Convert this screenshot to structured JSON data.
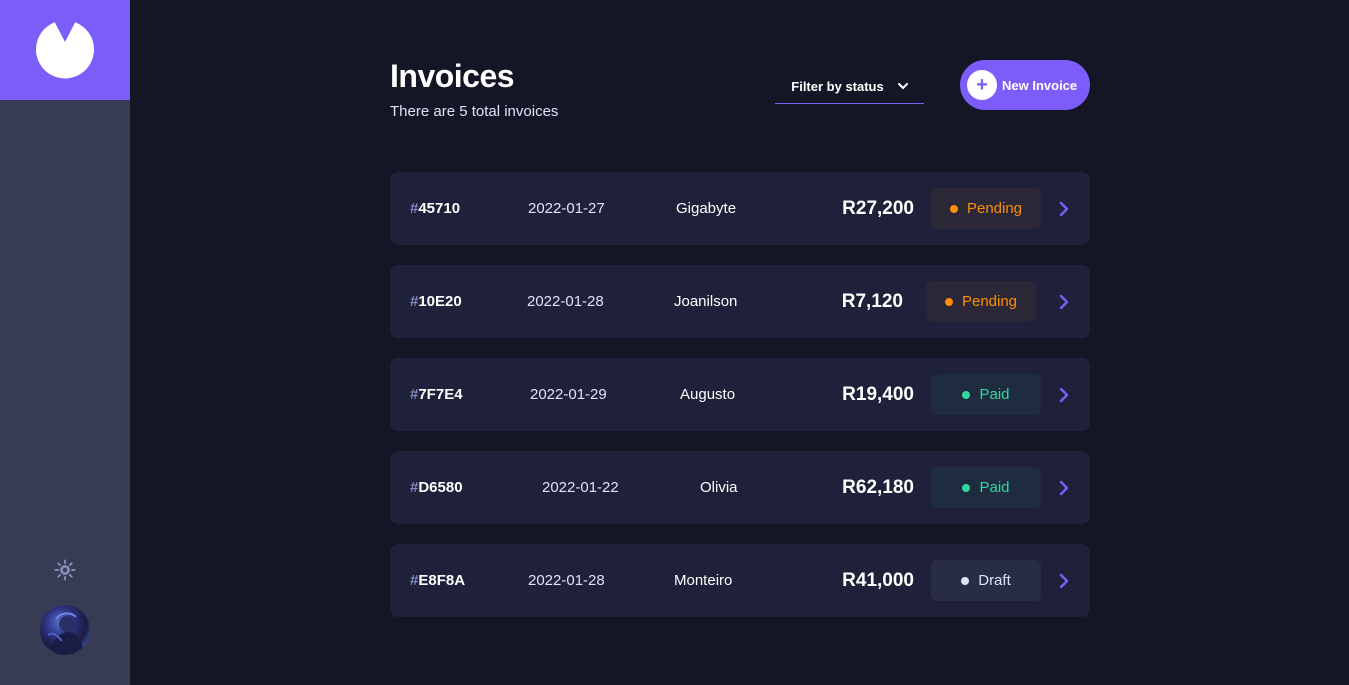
{
  "header": {
    "title": "Invoices",
    "subtitle": "There are 5 total invoices",
    "filter_label": "Filter by status",
    "new_button_label": "New Invoice"
  },
  "colors": {
    "accent": "#7c5dfa",
    "background": "#141625",
    "card": "#1e2139",
    "sidebar": "#373b53",
    "pending": "#ff8f00",
    "paid": "#33d69f",
    "draft": "#dfe3fa"
  },
  "icons": {
    "logo": "logo-icon",
    "theme": "sun-icon",
    "filter": "chevron-down-icon",
    "new": "plus-icon",
    "row": "chevron-right-icon"
  },
  "invoices": [
    {
      "hash": "#",
      "id": "45710",
      "date": "2022-01-27",
      "client": "Gigabyte",
      "amount": "R27,200",
      "status": "Pending",
      "status_key": "pending"
    },
    {
      "hash": "#",
      "id": "10E20",
      "date": "2022-01-28",
      "client": "Joanilson",
      "amount": "R7,120",
      "status": "Pending",
      "status_key": "pending"
    },
    {
      "hash": "#",
      "id": "7F7E4",
      "date": "2022-01-29",
      "client": "Augusto",
      "amount": "R19,400",
      "status": "Paid",
      "status_key": "paid"
    },
    {
      "hash": "#",
      "id": "D6580",
      "date": "2022-01-22",
      "client": "Olivia",
      "amount": "R62,180",
      "status": "Paid",
      "status_key": "paid"
    },
    {
      "hash": "#",
      "id": "E8F8A",
      "date": "2022-01-28",
      "client": "Monteiro",
      "amount": "R41,000",
      "status": "Draft",
      "status_key": "draft"
    }
  ]
}
